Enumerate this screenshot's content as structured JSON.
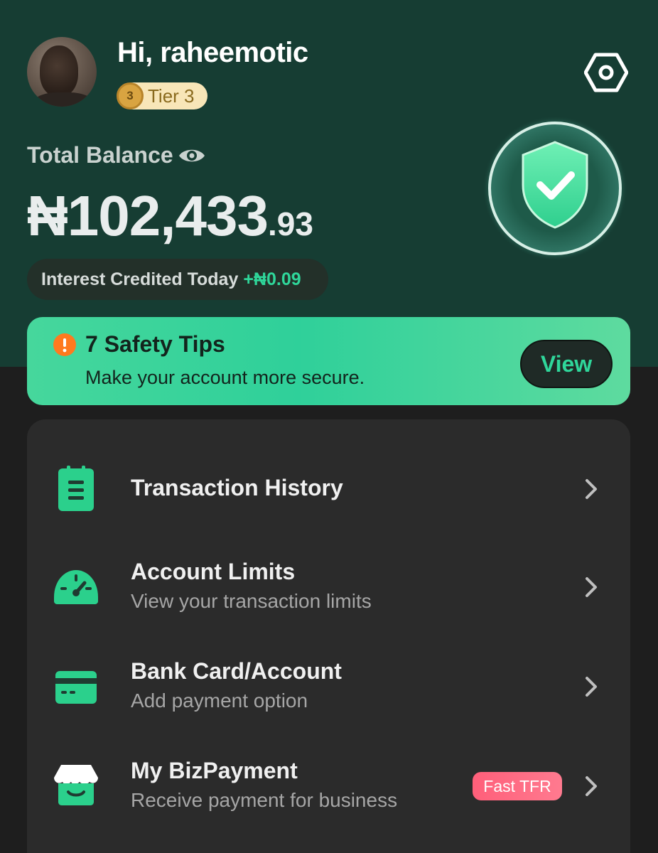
{
  "user": {
    "greeting": "Hi, raheemotic",
    "tier_number": "3",
    "tier_label": "Tier 3"
  },
  "balance": {
    "label": "Total Balance",
    "main": "₦102,433",
    "decimal": ".93",
    "interest_label": "Interest Credited Today ",
    "interest_amount": "+₦0.09"
  },
  "safety": {
    "title": "7 Safety Tips",
    "subtitle": "Make your account more secure.",
    "button": "View"
  },
  "menu": [
    {
      "title": "Transaction History",
      "subtitle": "",
      "icon": "clipboard-icon"
    },
    {
      "title": "Account Limits",
      "subtitle": "View your transaction limits",
      "icon": "speedometer-icon"
    },
    {
      "title": "Bank Card/Account",
      "subtitle": "Add payment option",
      "icon": "card-icon"
    },
    {
      "title": "My BizPayment",
      "subtitle": "Receive payment for business",
      "icon": "shop-icon",
      "badge": "Fast TFR"
    }
  ],
  "colors": {
    "header_bg": "#163d33",
    "accent_green": "#2fd69a",
    "banner_green": "#46d79c",
    "card_bg": "#2b2b2b",
    "badge_pink": "#ff5f7a"
  }
}
